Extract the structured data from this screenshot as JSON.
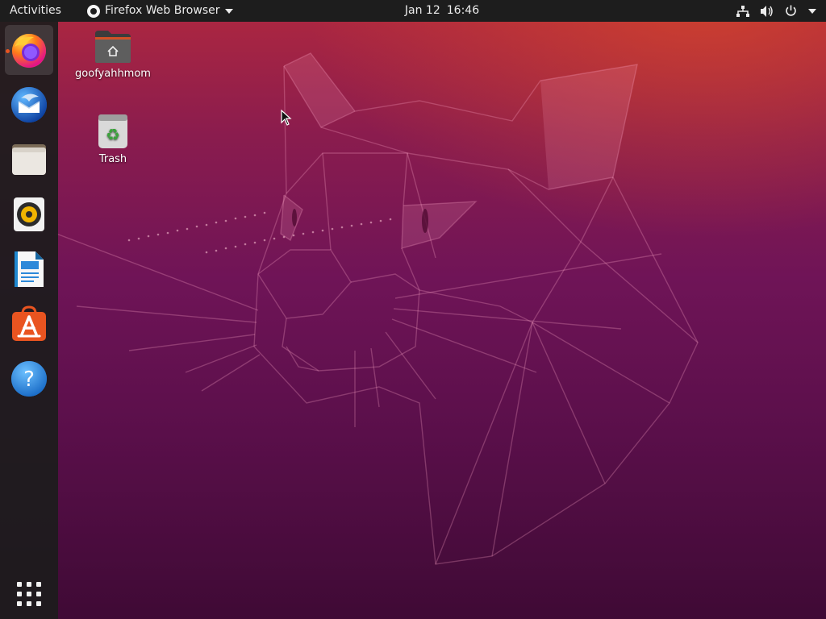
{
  "topbar": {
    "activities": "Activities",
    "app_menu": {
      "label": "Firefox Web Browser",
      "icon": "firefox-small-icon"
    },
    "clock": {
      "date": "Jan 12",
      "time": "16:46"
    },
    "tray_icons": [
      "network-wired-icon",
      "volume-icon",
      "power-icon",
      "chevron-down-icon"
    ]
  },
  "dock": {
    "items": [
      {
        "name": "Firefox",
        "icon": "firefox-icon",
        "active": true
      },
      {
        "name": "Thunderbird",
        "icon": "thunderbird-icon"
      },
      {
        "name": "Files",
        "icon": "files-icon"
      },
      {
        "name": "Rhythmbox",
        "icon": "rhythmbox-icon"
      },
      {
        "name": "LibreOffice Writer",
        "icon": "writer-icon"
      },
      {
        "name": "Ubuntu Software",
        "icon": "software-icon"
      },
      {
        "name": "Help",
        "icon": "help-icon"
      }
    ],
    "show_apps_icon": "grid-icon"
  },
  "desktop": {
    "icons": [
      {
        "label": "goofyahhmom",
        "icon": "home-folder-icon"
      },
      {
        "label": "Trash",
        "icon": "trash-icon"
      }
    ]
  },
  "colors": {
    "topbar": "#1d1d1d",
    "accent": "#e95420",
    "wallpaper_top": "#b0283f",
    "wallpaper_bottom": "#3f0a35"
  }
}
